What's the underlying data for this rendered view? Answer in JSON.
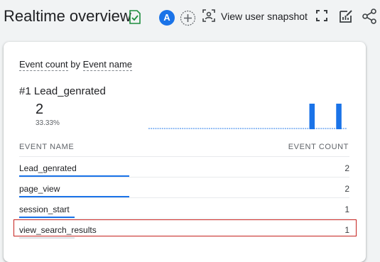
{
  "header": {
    "title": "Realtime overview",
    "avatar_letter": "A",
    "snapshot_label": "View user snapshot"
  },
  "card": {
    "metric": "Event count",
    "by": "by",
    "dimension": "Event name",
    "rank": "#1",
    "top_name": "Lead_genrated",
    "top_count": "2",
    "top_percent": "33.33%",
    "col_name": "EVENT NAME",
    "col_count": "EVENT COUNT",
    "rows": [
      {
        "name": "Lead_genrated",
        "count": "2",
        "share": 1.0
      },
      {
        "name": "page_view",
        "count": "2",
        "share": 1.0
      },
      {
        "name": "session_start",
        "count": "1",
        "share": 0.5
      },
      {
        "name": "view_search_results",
        "count": "1",
        "share": 0.5
      }
    ],
    "sparkline": [
      0,
      0,
      0,
      0,
      0,
      0,
      0,
      0,
      0,
      0,
      0,
      0,
      0,
      0,
      0,
      0,
      0,
      0,
      0,
      0,
      0,
      0,
      0,
      0,
      0,
      0,
      0,
      0,
      0,
      0,
      0,
      0,
      0,
      0,
      0,
      0,
      0,
      0,
      0,
      0,
      0,
      0,
      0,
      0,
      0,
      0,
      0,
      0,
      0,
      0,
      0,
      0,
      0,
      0,
      0,
      0,
      0,
      0,
      0,
      0,
      0,
      0,
      0,
      0,
      0,
      0,
      0,
      0,
      0,
      0,
      0,
      0,
      1,
      0,
      0,
      0,
      0,
      0,
      0,
      0,
      0,
      0,
      0,
      0,
      1,
      0,
      0,
      0,
      0
    ]
  },
  "colors": {
    "accent": "#1a73e8",
    "highlight": "#c5221f",
    "check": "#1e8e3e"
  }
}
